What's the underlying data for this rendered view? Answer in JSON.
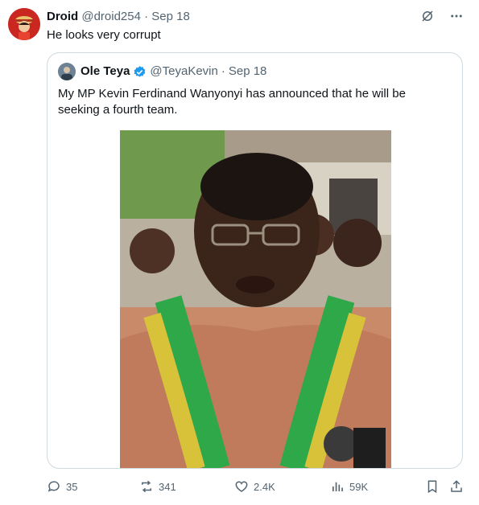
{
  "post": {
    "display_name": "Droid",
    "handle": "@droid254",
    "separator": "·",
    "date": "Sep 18",
    "text": "He looks very corrupt"
  },
  "quoted": {
    "display_name": "Ole Teya",
    "handle": "@TeyaKevin",
    "separator": "·",
    "date": "Sep 18",
    "text": "My MP Kevin Ferdinand Wanyonyi has announced that he will be seeking a fourth team."
  },
  "actions": {
    "replies": "35",
    "reposts": "341",
    "likes": "2.4K",
    "views": "59K"
  },
  "icons": [
    "grok-icon",
    "more-icon",
    "verified-badge-icon",
    "reply-icon",
    "repost-icon",
    "like-icon",
    "views-icon",
    "bookmark-icon",
    "share-icon"
  ],
  "colors": {
    "verified": "#1d9bf0",
    "muted": "#536471",
    "border": "#cfd9de"
  }
}
